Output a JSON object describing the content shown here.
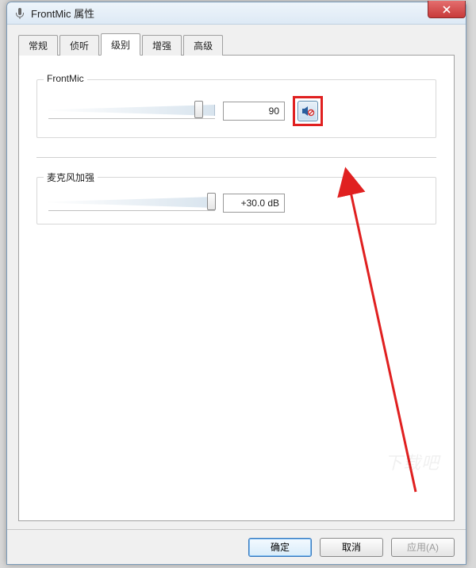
{
  "window": {
    "title": "FrontMic 属性"
  },
  "tabs": {
    "items": [
      {
        "label": "常规"
      },
      {
        "label": "侦听"
      },
      {
        "label": "级别"
      },
      {
        "label": "增强"
      },
      {
        "label": "高级"
      }
    ],
    "active_index": 2
  },
  "level": {
    "frontmic": {
      "label": "FrontMic",
      "value": "90",
      "slider_percent": 90
    },
    "boost": {
      "label": "麦克风加强",
      "value": "+30.0 dB",
      "slider_percent": 100
    }
  },
  "icons": {
    "close": "close-icon",
    "mute": "speaker-mute-icon",
    "app": "microphone-icon"
  },
  "buttons": {
    "ok": "确定",
    "cancel": "取消",
    "apply": "应用(A)"
  },
  "colors": {
    "highlight": "#e02020",
    "close_bg": "#c83a3a",
    "accent": "#3a7abd"
  }
}
